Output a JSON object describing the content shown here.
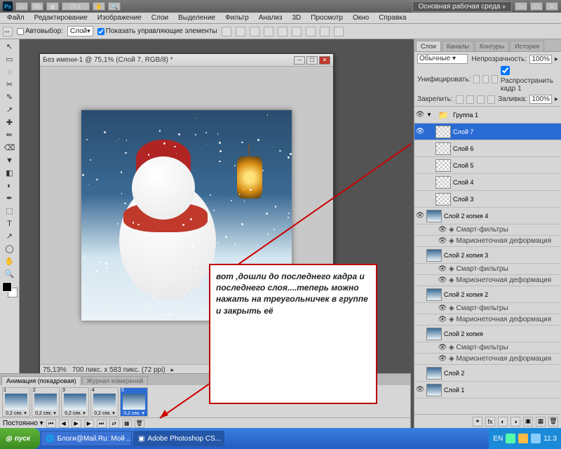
{
  "workspace_label": "Основная рабочая среда",
  "zoom_field": "75,1",
  "menu": [
    "Файл",
    "Редактирование",
    "Изображение",
    "Слои",
    "Выделение",
    "Фильтр",
    "Анализ",
    "3D",
    "Просмотр",
    "Окно",
    "Справка"
  ],
  "opt": {
    "autoselect": "Автовыбор:",
    "layer": "Слой",
    "show_controls": "Показать управляющие элементы"
  },
  "doc": {
    "title": "Без имени-1 @ 75,1% (Слой 7, RGB/8) *",
    "status_zoom": "75,13%",
    "status_doc": "700 пикс. x 583 пикс. (72 ppi)"
  },
  "callout_text": "вот ,дошли до последнего кадра и последнего слоя....теперь можно нажать на треугольничек в группе и закрыть её",
  "panel": {
    "tabs": [
      "Слои",
      "Каналы",
      "Контуры",
      "История"
    ],
    "mode": "Обычные",
    "opacity_lbl": "Непрозрачность:",
    "opacity": "100%",
    "unify": "Унифицировать:",
    "propagate": "Распространить кадр 1",
    "lock": "Закрепить:",
    "fill_lbl": "Заливка:",
    "fill": "100%"
  },
  "layers": [
    {
      "t": "group",
      "name": "Группа 1",
      "eye": true
    },
    {
      "t": "layer",
      "name": "Слой 7",
      "eye": true,
      "sel": true,
      "ind": 1
    },
    {
      "t": "layer",
      "name": "Слой 6",
      "eye": false,
      "ind": 1
    },
    {
      "t": "layer",
      "name": "Слой 5",
      "eye": false,
      "ind": 1
    },
    {
      "t": "layer",
      "name": "Слой 4",
      "eye": false,
      "ind": 1
    },
    {
      "t": "layer",
      "name": "Слой 3",
      "eye": false,
      "ind": 1
    },
    {
      "t": "smart",
      "name": "Слой 2 копия 4",
      "eye": true,
      "pic": true
    },
    {
      "t": "sub",
      "name": "Смарт-фильтры"
    },
    {
      "t": "sub",
      "name": "Марионеточная деформация"
    },
    {
      "t": "smart",
      "name": "Слой 2 копия 3",
      "pic": true
    },
    {
      "t": "sub",
      "name": "Смарт-фильтры"
    },
    {
      "t": "sub",
      "name": "Марионеточная деформация"
    },
    {
      "t": "smart",
      "name": "Слой 2 копия 2",
      "pic": true
    },
    {
      "t": "sub",
      "name": "Смарт-фильтры"
    },
    {
      "t": "sub",
      "name": "Марионеточная деформация"
    },
    {
      "t": "smart",
      "name": "Слой 2 копия",
      "pic": true
    },
    {
      "t": "sub",
      "name": "Смарт-фильтры"
    },
    {
      "t": "sub",
      "name": "Марионеточная деформация"
    },
    {
      "t": "layer",
      "name": "Слой 2",
      "pic": true
    },
    {
      "t": "layer",
      "name": "Слой 1",
      "eye": true,
      "pic": true
    }
  ],
  "anim": {
    "tab1": "Анимация (покадровая)",
    "tab2": "Журнал измерений",
    "loop": "Постоянно",
    "delay": "0,2 сек."
  },
  "frames": [
    1,
    2,
    3,
    4,
    5
  ],
  "frame_sel": 5,
  "taskbar": {
    "start": "пуск",
    "items": [
      "Блоги@Mail.Ru: Мой ...",
      "Adobe Photoshop CS..."
    ],
    "lang": "EN",
    "time": "11:3"
  }
}
